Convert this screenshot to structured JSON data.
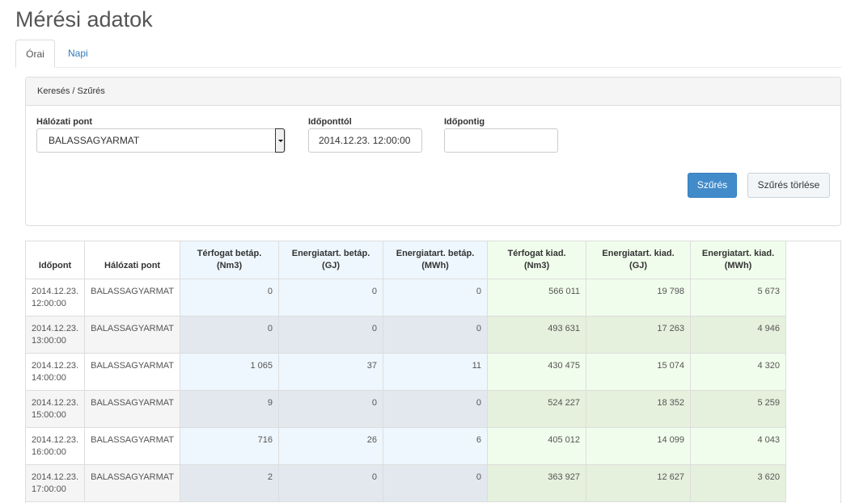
{
  "page": {
    "title": "Mérési adatok"
  },
  "tabs": [
    {
      "label": "Órai",
      "active": true
    },
    {
      "label": "Napi",
      "active": false
    }
  ],
  "filter": {
    "heading": "Keresés / Szűrés",
    "network_point": {
      "label": "Hálózati pont",
      "value": "BALASSAGYARMAT"
    },
    "from": {
      "label": "Időponttól",
      "value": "2014.12.23. 12:00:00"
    },
    "to": {
      "label": "Időpontig",
      "value": ""
    },
    "filter_button": "Szűrés",
    "clear_button": "Szűrés törlése"
  },
  "table": {
    "columns": [
      {
        "line1": "Időpont",
        "line2": ""
      },
      {
        "line1": "Hálózati pont",
        "line2": ""
      },
      {
        "line1": "Térfogat betáp.",
        "line2": "(Nm3)"
      },
      {
        "line1": "Energiatart. betáp.",
        "line2": "(GJ)"
      },
      {
        "line1": "Energiatart. betáp.",
        "line2": "(MWh)"
      },
      {
        "line1": "Térfogat kiad.",
        "line2": "(Nm3)"
      },
      {
        "line1": "Energiatart. kiad.",
        "line2": "(GJ)"
      },
      {
        "line1": "Energiatart. kiad.",
        "line2": "(MWh)"
      }
    ],
    "rows": [
      {
        "date": "2014.12.23.",
        "time": "12:00:00",
        "point": "BALASSAGYARMAT",
        "vol_in": "0",
        "gj_in": "0",
        "mwh_in": "0",
        "vol_out": "566 011",
        "gj_out": "19 798",
        "mwh_out": "5 673"
      },
      {
        "date": "2014.12.23.",
        "time": "13:00:00",
        "point": "BALASSAGYARMAT",
        "vol_in": "0",
        "gj_in": "0",
        "mwh_in": "0",
        "vol_out": "493 631",
        "gj_out": "17 263",
        "mwh_out": "4 946"
      },
      {
        "date": "2014.12.23.",
        "time": "14:00:00",
        "point": "BALASSAGYARMAT",
        "vol_in": "1 065",
        "gj_in": "37",
        "mwh_in": "11",
        "vol_out": "430 475",
        "gj_out": "15 074",
        "mwh_out": "4 320"
      },
      {
        "date": "2014.12.23.",
        "time": "15:00:00",
        "point": "BALASSAGYARMAT",
        "vol_in": "9",
        "gj_in": "0",
        "mwh_in": "0",
        "vol_out": "524 227",
        "gj_out": "18 352",
        "mwh_out": "5 259"
      },
      {
        "date": "2014.12.23.",
        "time": "16:00:00",
        "point": "BALASSAGYARMAT",
        "vol_in": "716",
        "gj_in": "26",
        "mwh_in": "6",
        "vol_out": "405 012",
        "gj_out": "14 099",
        "mwh_out": "4 043"
      },
      {
        "date": "2014.12.23.",
        "time": "17:00:00",
        "point": "BALASSAGYARMAT",
        "vol_in": "2",
        "gj_in": "0",
        "mwh_in": "0",
        "vol_out": "363 927",
        "gj_out": "12 627",
        "mwh_out": "3 620"
      }
    ]
  }
}
